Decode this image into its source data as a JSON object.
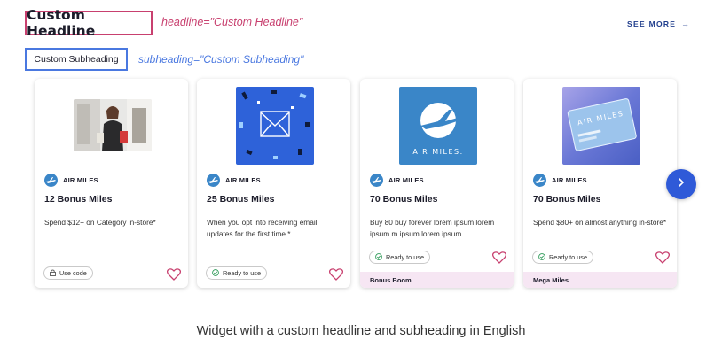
{
  "header": {
    "headline": "Custom Headline",
    "headline_annotation": "headline=\"Custom Headline\"",
    "subheading": "Custom Subheading",
    "subheading_annotation": "subheading=\"Custom Subheading\"",
    "see_more": "SEE MORE",
    "see_more_arrow": "→"
  },
  "cards": [
    {
      "brand": "AIR MILES",
      "title": "12 Bonus Miles",
      "description": "Spend $12+ on Category in-store*",
      "badge": "Use code",
      "badge_icon": "lock-icon",
      "footer": ""
    },
    {
      "brand": "AIR MILES",
      "title": "25 Bonus Miles",
      "description": "When you opt into receiving email updates for the first time.*",
      "badge": "Ready to use",
      "badge_icon": "check-circle-icon",
      "footer": ""
    },
    {
      "brand": "AIR MILES",
      "title": "70 Bonus Miles",
      "description": "Buy 80 buy forever lorem ipsum lorem ipsum m ipsum lorem ipsum...",
      "badge": "Ready to use",
      "badge_icon": "check-circle-icon",
      "footer": "Bonus Boom",
      "image_text": "AIR MILES."
    },
    {
      "brand": "AIR MILES",
      "title": "70 Bonus Miles",
      "description": "Spend $80+ on almost anything in-store*",
      "badge": "Ready to use",
      "badge_icon": "check-circle-icon",
      "footer": "Mega Miles",
      "image_text": "AIR MILES"
    }
  ],
  "carousel": {
    "next_icon": "chevron-right-icon",
    "next_glyph": "›"
  },
  "caption": "Widget with a custom headline and subheading in English",
  "colors": {
    "headline_border": "#c8406f",
    "subheading_border": "#4a78e0",
    "accent_blue": "#2f5ad8",
    "footer_pink": "#f6e6f3"
  }
}
